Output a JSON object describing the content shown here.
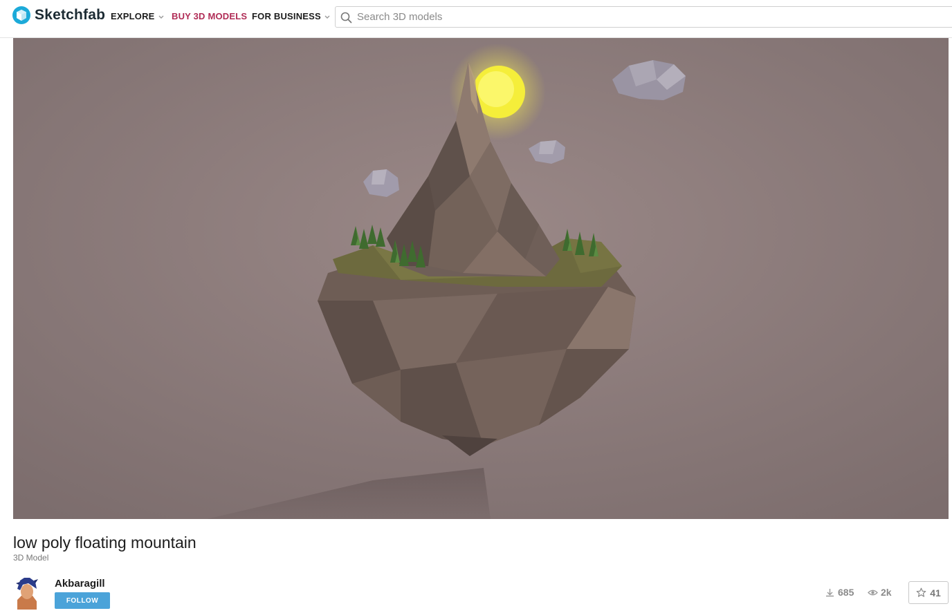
{
  "header": {
    "brand": "Sketchfab",
    "nav": {
      "explore": "EXPLORE",
      "buy": "BUY 3D MODELS",
      "business": "FOR BUSINESS"
    },
    "search_placeholder": "Search 3D models"
  },
  "model": {
    "title": "low poly floating mountain",
    "type": "3D Model"
  },
  "author": {
    "name": "Akbaragill",
    "follow_label": "FOLLOW"
  },
  "stats": {
    "downloads": "685",
    "views": "2k",
    "likes": "41"
  },
  "colors": {
    "brand": "#1caad9",
    "buy_link": "#b02c56",
    "follow_button": "#4ba3d9",
    "viewer_background": "#8c7a7a"
  },
  "icons": {
    "logo": "sketchfab-cube-icon",
    "search": "search-icon",
    "downloads": "download-icon",
    "views": "eye-icon",
    "likes": "star-icon"
  }
}
